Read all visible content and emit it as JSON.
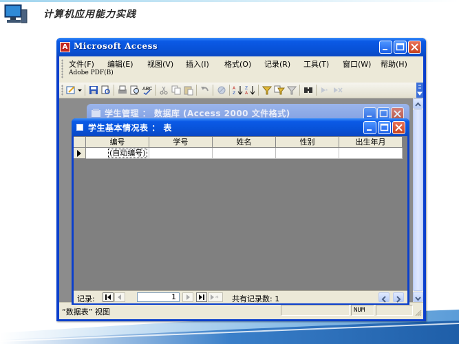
{
  "slide": {
    "title": "计算机应用能力实践"
  },
  "app": {
    "title": "Microsoft Access",
    "menu": [
      {
        "label": "文件(F)"
      },
      {
        "label": "编辑(E)"
      },
      {
        "label": "视图(V)"
      },
      {
        "label": "插入(I)"
      },
      {
        "label": "格式(O)"
      },
      {
        "label": "记录(R)"
      },
      {
        "label": "工具(T)"
      },
      {
        "label": "窗口(W)"
      },
      {
        "label": "帮助(H)"
      },
      {
        "label": "Adobe PDF(B)"
      }
    ],
    "toolbar_icons": [
      "design-view-icon",
      "save-icon",
      "print-icon",
      "print-preview-icon",
      "spelling-icon",
      "cut-icon",
      "copy-icon",
      "paste-icon",
      "undo-icon",
      "hyperlink-icon",
      "sort-ascending-icon",
      "sort-descending-icon",
      "filter-by-selection-icon",
      "filter-by-form-icon",
      "apply-filter-icon",
      "find-icon",
      "new-record-icon",
      "delete-record-icon"
    ],
    "status_text": "“数据表” 视图",
    "status_num": "NUM"
  },
  "db_window": {
    "title": "学生管理 ： 数据库 (Access 2000 文件格式)"
  },
  "table_window": {
    "title": "学生基本情况表 ： 表",
    "columns": [
      "编号",
      "学号",
      "姓名",
      "性别",
      "出生年月"
    ],
    "new_row": {
      "id_placeholder": "(自动编号)"
    },
    "nav": {
      "label": "记录:",
      "current_record": "1",
      "total_label": "共有记录数: 1"
    }
  }
}
